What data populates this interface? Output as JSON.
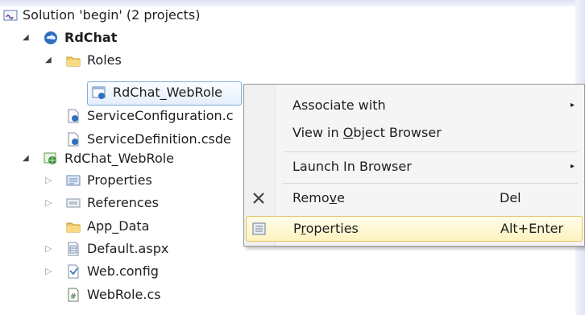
{
  "tree": {
    "solution": {
      "label": "Solution 'begin' (2 projects)",
      "icon": "solution-icon"
    },
    "rdchat": {
      "label": "RdChat",
      "icon": "cloud-project-icon",
      "expander": "◢"
    },
    "roles": {
      "label": "Roles",
      "icon": "folder-icon",
      "expander": "◢"
    },
    "webrole_ref": {
      "label": "RdChat_WebRole",
      "icon": "web-role-icon"
    },
    "service_config": {
      "label": "ServiceConfiguration.c",
      "icon": "config-file-icon"
    },
    "service_def": {
      "label": "ServiceDefinition.csde",
      "icon": "config-file-icon"
    },
    "webrole_project": {
      "label": "RdChat_WebRole",
      "icon": "web-project-icon",
      "expander": "◢"
    },
    "properties": {
      "label": "Properties",
      "icon": "properties-icon",
      "expander": "▷"
    },
    "references": {
      "label": "References",
      "icon": "references-icon",
      "expander": "▷"
    },
    "app_data": {
      "label": "App_Data",
      "icon": "folder-icon"
    },
    "default_aspx": {
      "label": "Default.aspx",
      "icon": "aspx-file-icon",
      "expander": "▷"
    },
    "web_config": {
      "label": "Web.config",
      "icon": "config-file-icon",
      "expander": "▷"
    },
    "webrole_cs": {
      "label": "WebRole.cs",
      "icon": "csharp-file-icon"
    }
  },
  "context_menu": {
    "associate": {
      "pre": "Associate with",
      "arrow": "▸"
    },
    "view_object": {
      "pre": "View in ",
      "u": "O",
      "post": "bject Browser"
    },
    "launch": {
      "pre": "Launch In Browser",
      "arrow": "▸"
    },
    "remove": {
      "pre": "Remo",
      "u": "v",
      "post": "e",
      "shortcut": "Del",
      "icon": "close-icon"
    },
    "properties": {
      "pre": "P",
      "u": "r",
      "post": "operties",
      "shortcut": "Alt+Enter",
      "icon": "properties-icon"
    }
  }
}
